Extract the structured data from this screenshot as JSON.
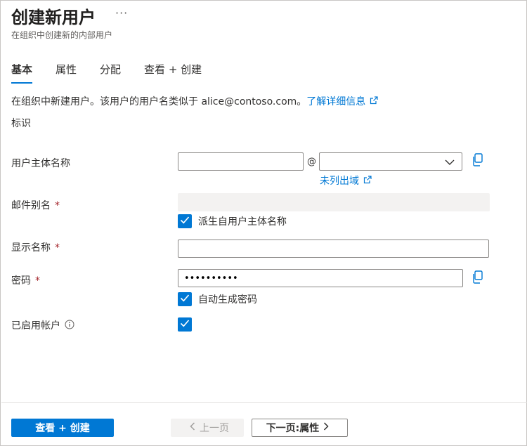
{
  "header": {
    "title": "创建新用户",
    "more": "···",
    "subtitle": "在组织中创建新的内部用户"
  },
  "tabs": [
    {
      "label": "基本",
      "active": true
    },
    {
      "label": "属性",
      "active": false
    },
    {
      "label": "分配",
      "active": false
    },
    {
      "label": "查看 + 创建",
      "active": false
    }
  ],
  "intro": {
    "text": "在组织中新建用户。该用户的用户名类似于 alice@contoso.com。",
    "link": "了解详细信息"
  },
  "section_title": "标识",
  "form": {
    "upn": {
      "label": "用户主体名称",
      "value": "",
      "at": "@",
      "domain_value": "",
      "domain_link": "未列出域"
    },
    "mail_nickname": {
      "label": "邮件别名",
      "required": "*",
      "value": "",
      "checkbox_label": "派生自用户主体名称",
      "checked": true
    },
    "display_name": {
      "label": "显示名称",
      "required": "*",
      "value": ""
    },
    "password": {
      "label": "密码",
      "required": "*",
      "value": "••••••••••",
      "checkbox_label": "自动生成密码",
      "checked": true
    },
    "account_enabled": {
      "label": "已启用帐户",
      "checked": true
    }
  },
  "footer": {
    "review_create": "查看 + 创建",
    "prev": "上一页",
    "next": "下一页:属性"
  },
  "colors": {
    "accent": "#0078d4",
    "required": "#a4262c"
  },
  "icons": [
    "ellipsis-icon",
    "external-link-icon",
    "chevron-down-icon",
    "copy-icon",
    "checkmark-icon",
    "info-icon",
    "chevron-left-icon",
    "chevron-right-icon"
  ]
}
